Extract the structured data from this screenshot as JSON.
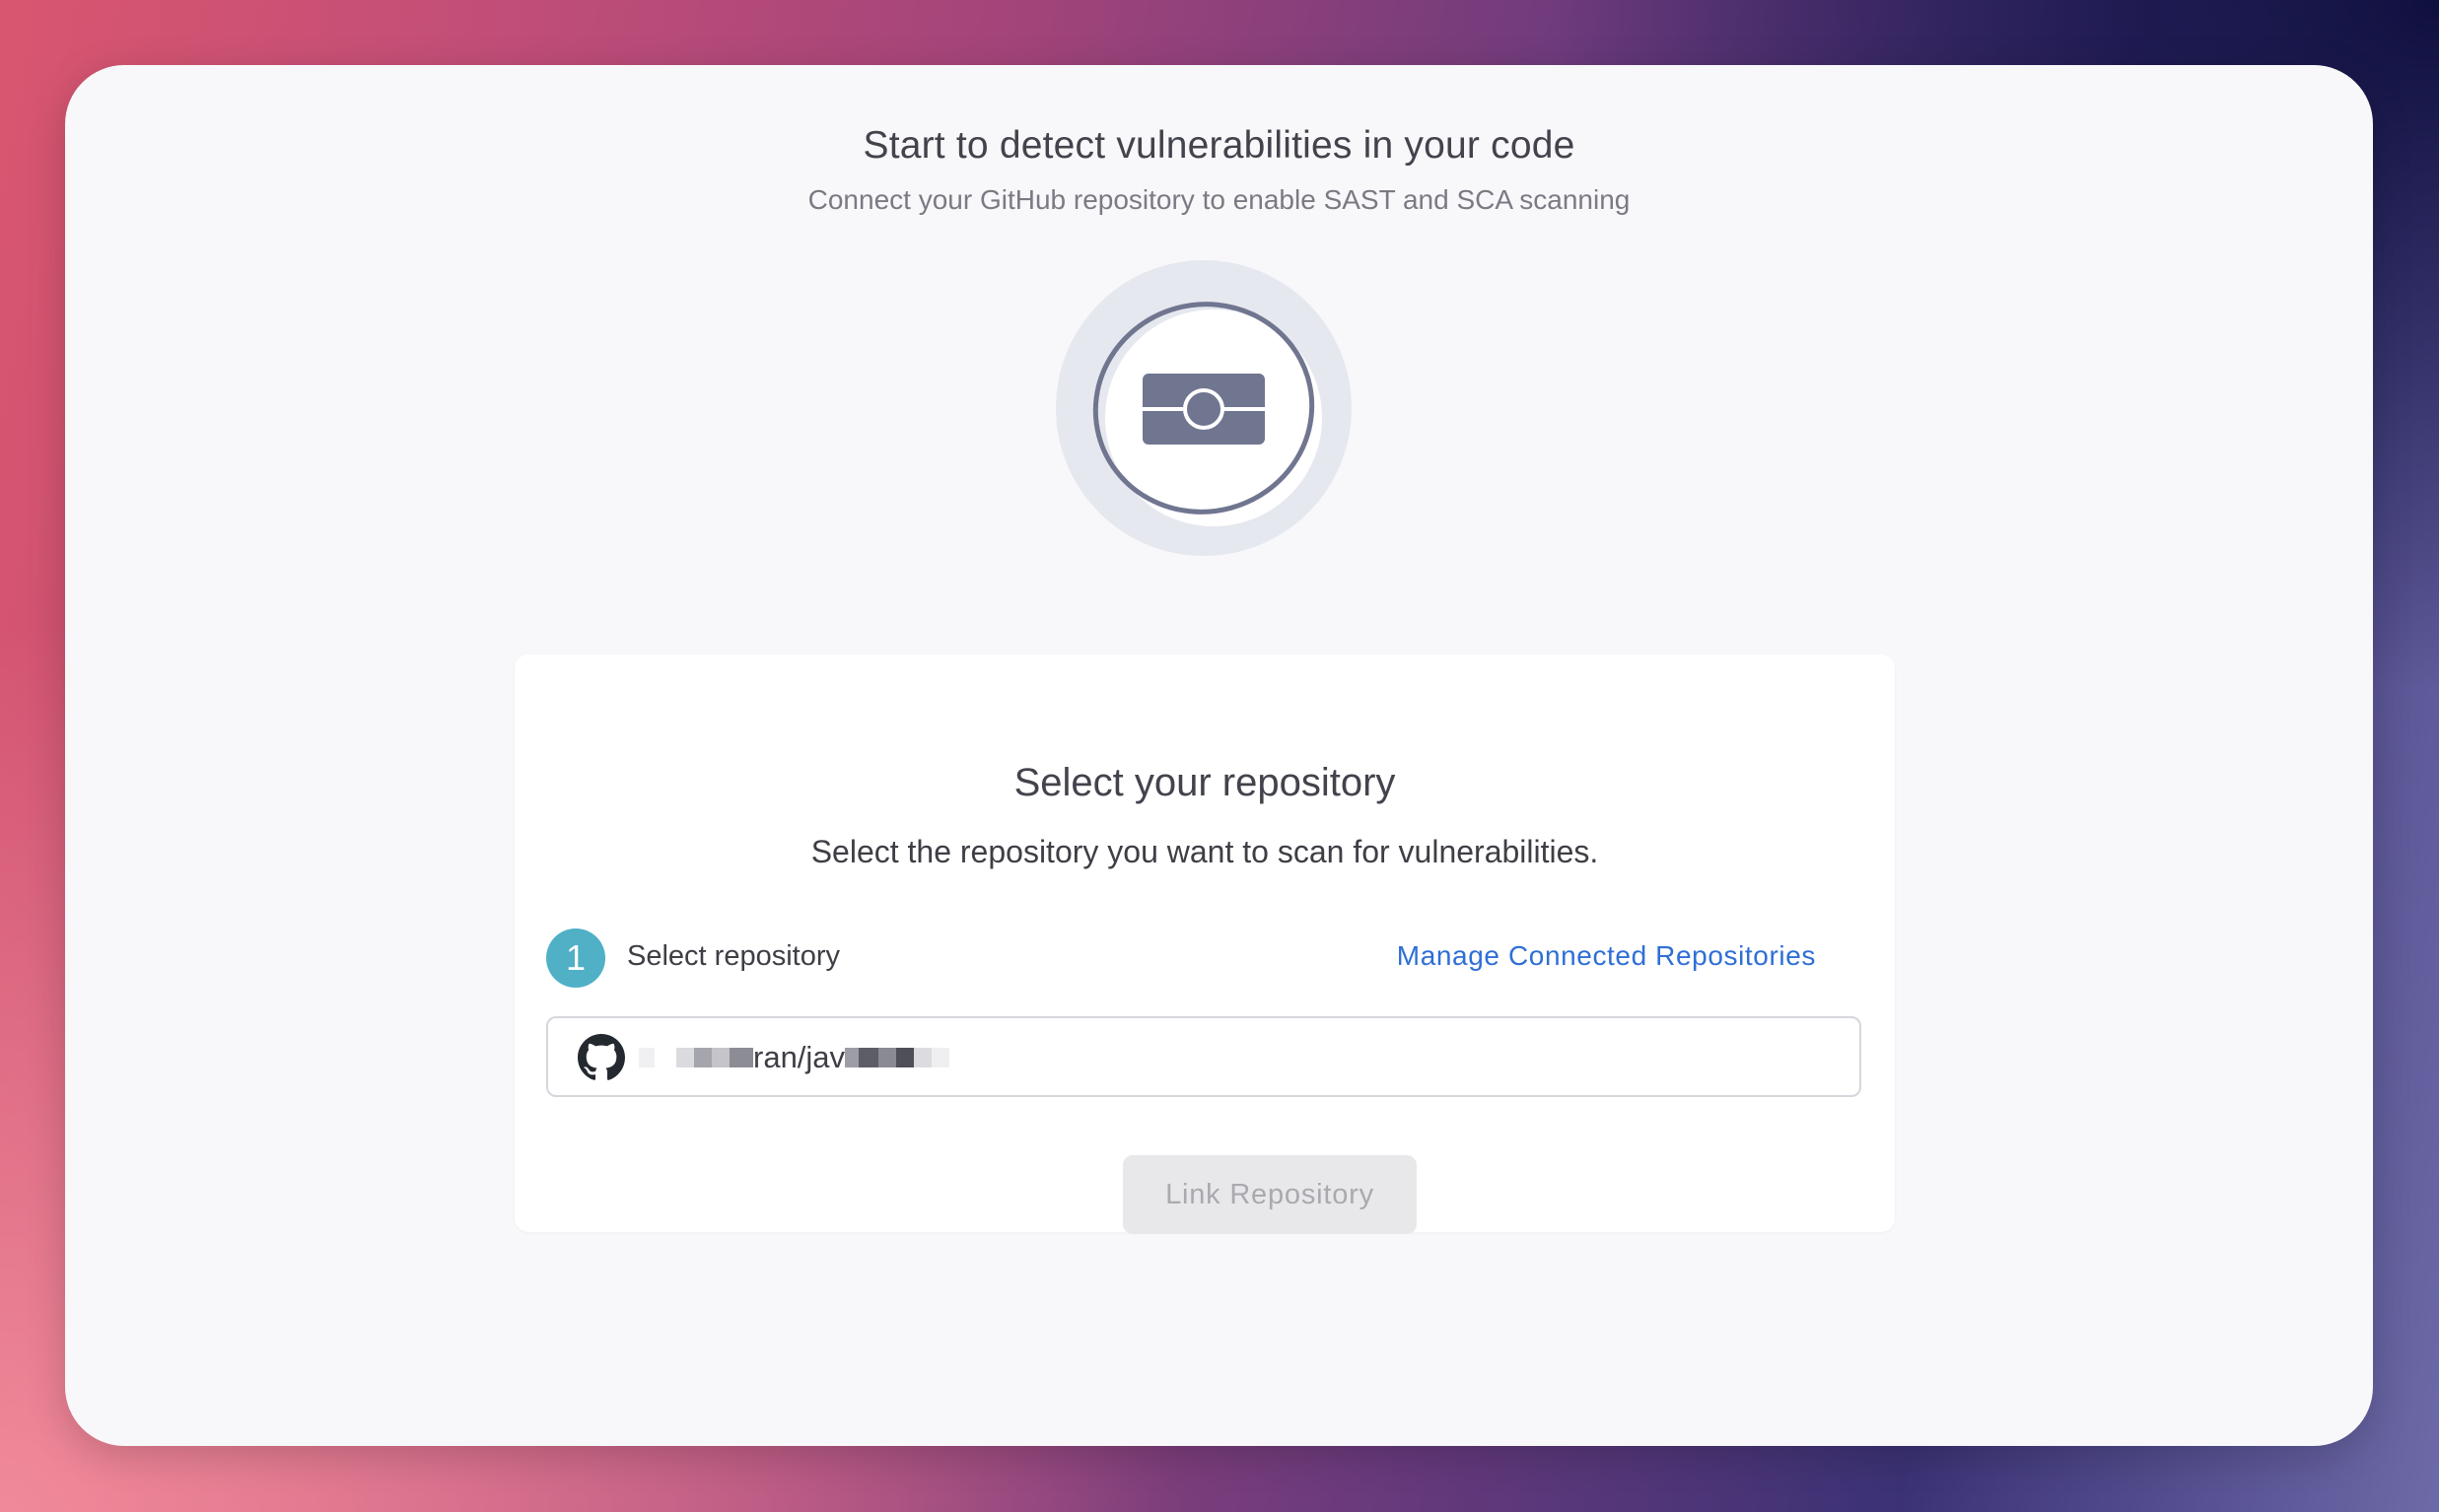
{
  "hero": {
    "title": "Start to detect vulnerabilities in your code",
    "subtitle": "Connect your GitHub repository to enable SAST and SCA scanning",
    "illustration_icon": "connector-card-icon"
  },
  "card": {
    "title": "Select your repository",
    "description": "Select the repository you want to scan for vulnerabilities.",
    "step": {
      "number": "1",
      "label": "Select repository"
    },
    "manage_link": "Manage Connected Repositories",
    "repository_select": {
      "icon": "github-icon",
      "value_visible": "ran/jav",
      "value_note_redacted": true
    },
    "link_button": {
      "label": "Link Repository",
      "disabled": true
    }
  },
  "colors": {
    "accent": "#4fb0c6",
    "link": "#2e6fd6",
    "text": "#43434d",
    "icon": "#707590"
  }
}
